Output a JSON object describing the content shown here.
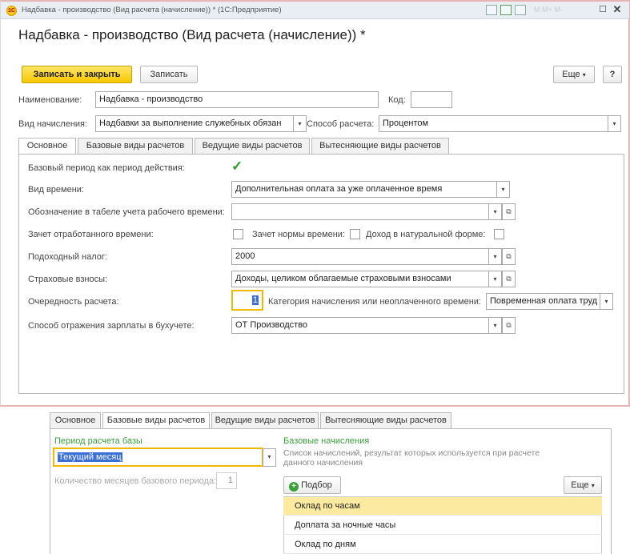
{
  "window": {
    "title_bar": "Надбавка - производство (Вид расчета (начисление)) * (1С:Предприятие)",
    "logo_text": "1С",
    "faded_controls": "M  M+  M-",
    "form_title": "Надбавка - производство (Вид расчета (начисление)) *"
  },
  "toolbar": {
    "save_close": "Записать и закрыть",
    "save": "Записать",
    "more": "Еще",
    "help": "?"
  },
  "header": {
    "name_label": "Наименование:",
    "name_value": "Надбавка - производство",
    "code_label": "Код:",
    "code_value": "",
    "kind_label": "Вид начисления:",
    "kind_value": "Надбавки за выполнение служебных обязан",
    "method_label": "Способ расчета:",
    "method_value": "Процентом"
  },
  "tabs": [
    "Основное",
    "Базовые виды расчетов",
    "Ведущие виды расчетов",
    "Вытесняющие виды расчетов"
  ],
  "main": {
    "base_period_label": "Базовый период как период действия:",
    "base_period_checked": true,
    "time_kind_label": "Вид времени:",
    "time_kind_value": "Дополнительная оплата за уже оплаченное время",
    "timesheet_label": "Обозначение в табеле учета рабочего времени:",
    "timesheet_value": "",
    "worked_time_label": "Зачет отработанного времени:",
    "norm_label": "Зачет нормы времени:",
    "natural_label": "Доход в натуральной форме:",
    "tax_label": "Подоходный налог:",
    "tax_value": "2000",
    "insurance_label": "Страховые взносы:",
    "insurance_value": "Доходы, целиком облагаемые страховыми взносами",
    "order_label": "Очередность расчета:",
    "order_value": "1",
    "category_label": "Категория начисления или неоплаченного времени:",
    "category_value": "Повременная оплата труд",
    "accounting_label": "Способ отражения зарплаты в бухучете:",
    "accounting_value": "ОТ Производство"
  },
  "base_tab": {
    "period_label": "Период расчета базы",
    "period_value": "Текущий месяц",
    "months_label": "Количество месяцев базового периода:",
    "months_value": "1",
    "accruals_label": "Базовые начисления",
    "accruals_note": "Список начислений, результат которых используется при расчете данного начисления",
    "pick_button": "Подбор",
    "more_button": "Еще",
    "accruals": [
      "Оклад по часам",
      "Доплата за ночные часы",
      "Оклад по дням"
    ]
  },
  "colors": {
    "accent": "#f7c800",
    "green": "#3aa03a",
    "selected_row": "#fbeaa0"
  }
}
